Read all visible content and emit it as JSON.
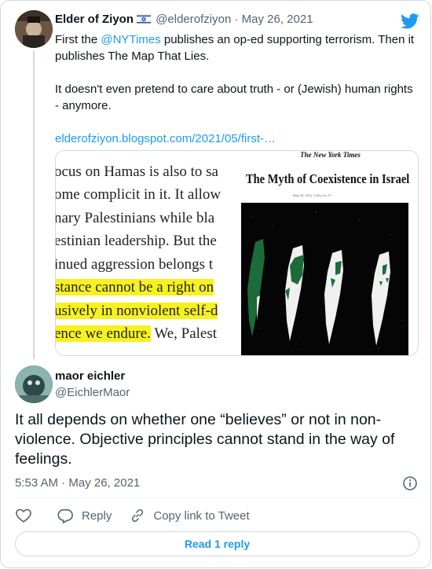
{
  "parent_tweet": {
    "author_name": "Elder of Ziyon",
    "flag_icon": "israel-flag-icon",
    "handle": "@elderofziyon",
    "separator": "·",
    "date": "May 26, 2021",
    "text_line1_prefix": "First the ",
    "mention": "@NYTimes",
    "text_line1_suffix": " publishes an op-ed supporting terrorism. Then it publishes The Map That Lies.",
    "text_para2": "It doesn't even pretend to care about truth - or (Jewish) human rights - anymore.",
    "link": "elderofziyon.blogspot.com/2021/05/first-…",
    "media": {
      "excerpt_lines": [
        {
          "text": "ocus on Hamas is also to sa",
          "highlight": false
        },
        {
          "text": "ome complicit in it. It allow",
          "highlight": false
        },
        {
          "text": "nary Palestinians while bla",
          "highlight": false
        },
        {
          "text": "estinian leadership. But the",
          "highlight": false
        },
        {
          "text": "inued aggression belongs t",
          "highlight": false
        },
        {
          "text": "stance cannot be a right on",
          "highlight": true
        },
        {
          "text": "usively in nonviolent self-d",
          "highlight": true
        },
        {
          "text": "ence we endure.",
          "highlight": true,
          "rest": " We, Palest"
        }
      ],
      "newspaper_logo": "The New York Times",
      "article_title": "The Myth of Coexistence in Israel",
      "article_date": "May 25, 2021, 4:30 p.m. ET"
    }
  },
  "reply_tweet": {
    "author_name": "maor eichler",
    "handle": "@EichlerMaor",
    "text": "It all depends on whether one “believes” or not in non-violence. Objective principles cannot stand in the way of feelings.",
    "timestamp": "5:53 AM · May 26, 2021"
  },
  "actions": {
    "like_icon": "heart-icon",
    "reply_label": "Reply",
    "copy_label": "Copy link to Tweet"
  },
  "read_replies_label": "Read 1 reply",
  "colors": {
    "twitter_blue": "#1d9bf0",
    "secondary_text": "#536471",
    "border": "#cfd9de",
    "highlight": "#f7f21e",
    "map_green": "#1c6b3a"
  }
}
